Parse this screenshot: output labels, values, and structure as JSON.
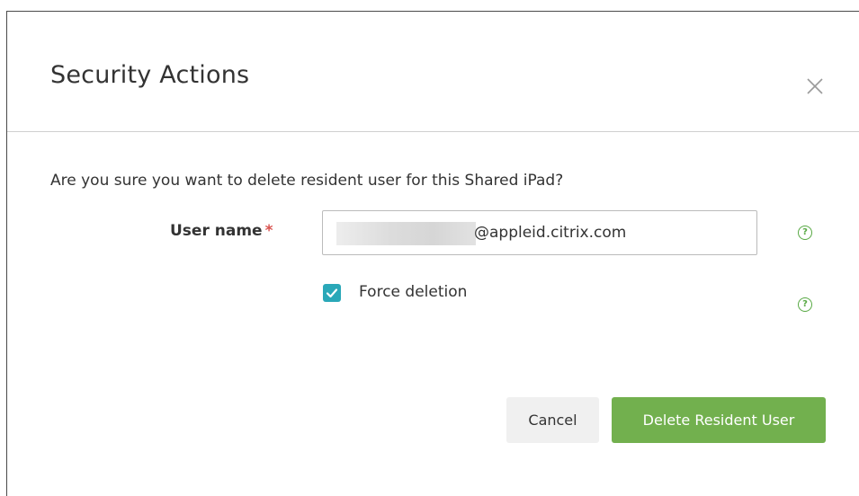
{
  "dialog": {
    "title": "Security Actions",
    "close_icon": "close-icon",
    "question": "Are you sure you want to delete resident user for this Shared iPad?"
  },
  "form": {
    "username_label": "User name",
    "required_marker": "*",
    "username_value": "@appleid.citrix.com",
    "help_icon": "?",
    "force_deletion_label": "Force deletion",
    "force_deletion_checked": true
  },
  "actions": {
    "cancel_label": "Cancel",
    "delete_label": "Delete Resident User"
  },
  "colors": {
    "accent_green": "#72b04e",
    "checkbox_teal": "#2aa8b8",
    "required_red": "#d9534f",
    "help_green": "#58a944"
  }
}
